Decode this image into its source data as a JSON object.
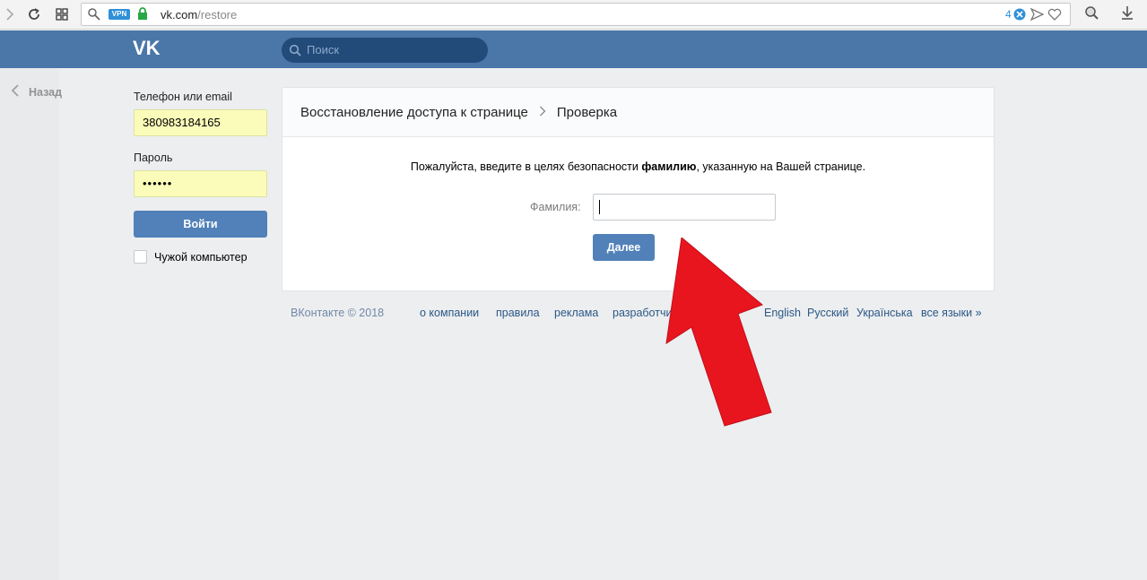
{
  "browser": {
    "vpn_label": "VPN",
    "url_host": "vk.com",
    "url_path": "/restore",
    "tab_count": "4"
  },
  "header": {
    "search_placeholder": "Поиск"
  },
  "back": {
    "label": "Назад"
  },
  "login": {
    "phone_label": "Телефон или email",
    "phone_value": "380983184165",
    "password_label": "Пароль",
    "password_value": "••••••",
    "login_button": "Войти",
    "foreign_pc_label": "Чужой компьютер"
  },
  "card": {
    "crumb_main": "Восстановление доступа к странице",
    "crumb_current": "Проверка",
    "message_before": "Пожалуйста, введите в целях безопасности ",
    "message_bold": "фамилию",
    "message_after": ", указанную на Вашей странице.",
    "surname_label": "Фамилия:",
    "next_button": "Далее"
  },
  "footer": {
    "copyright": "ВКонтакте © 2018",
    "links": [
      "о компании",
      "правила",
      "реклама",
      "разработчикам",
      "English",
      "Русский",
      "Українська",
      "все языки »"
    ]
  },
  "colors": {
    "vk_blue": "#4a76a8",
    "button_blue": "#5181b8",
    "autofill_yellow": "#fbfcb9",
    "arrow_red": "#e8151f"
  }
}
